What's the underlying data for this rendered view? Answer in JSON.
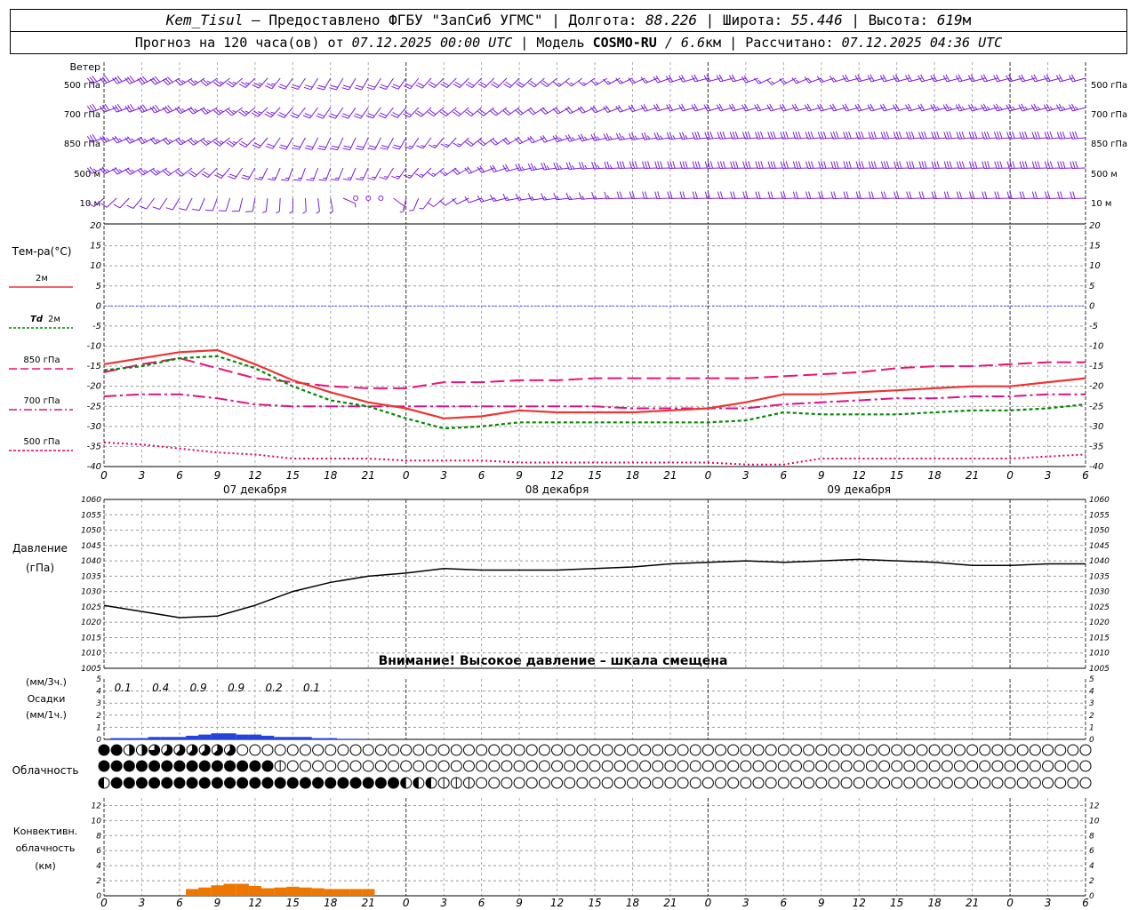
{
  "header": {
    "station": "Kem_Tisul",
    "provider": "– Предоставлено ФГБУ \"ЗапСиб УГМС\"",
    "lon_label": "Долгота:",
    "lon": "88.226",
    "lat_label": "Широта:",
    "lat": "55.446",
    "alt_label": "Высота:",
    "alt": "619",
    "alt_unit": "м",
    "forecast_label": "Прогноз на 120 часа(ов) от",
    "forecast_from": "07.12.2025 00:00 UTC",
    "model_label": "Модель",
    "model": "COSMO-RU",
    "resolution": "/ 6.6",
    "resolution_unit": "км",
    "calc_label": "Рассчитано:",
    "calc_time": "07.12.2025 04:36 UTC"
  },
  "labels": {
    "wind_title": "Ветер",
    "wind_levels": [
      "500 гПа",
      "700 гПа",
      "850 гПа",
      "500 м",
      "10  м"
    ],
    "temp_title": "Тем-ра(°C)",
    "temp_2m": "2м",
    "td_prefix": "Td",
    "td_2m": "2м",
    "t850": "850 гПа",
    "t700": "700 гПа",
    "t500": "500 гПа",
    "pressure_title": "Давление",
    "pressure_unit": "(гПа)",
    "warning": "Внимание! Высокое давление – шкала смещена",
    "precip_unit3": "(мм/3ч.)",
    "precip_title": "Осадки",
    "precip_unit1": "(мм/1ч.)",
    "cloud_title": "Облачность",
    "conv_title1": "Конвективн.",
    "conv_title2": "облачность",
    "conv_unit": "(км)"
  },
  "colors": {
    "wind": "#7b1fd6",
    "t2m": "#ee3333",
    "td": "#008800",
    "t850": "#ee1177",
    "t700": "#dd1188",
    "t500": "#dd0066",
    "zero": "#3355ff",
    "pressure": "#000000",
    "precip": "#2244dd",
    "conv": "#ee7700"
  },
  "chart_data": [
    {
      "type": "wind-barbs",
      "levels": [
        "500 гПа",
        "700 гПа",
        "850 гПа",
        "500 м",
        "10  м"
      ],
      "x_hours": [
        0,
        3,
        6,
        9,
        12,
        15,
        18,
        21,
        24,
        27,
        30,
        33,
        36,
        39,
        42,
        45,
        48,
        51,
        54,
        57,
        60,
        63,
        66,
        69,
        72,
        75,
        78
      ],
      "direction_deg": [
        [
          245,
          245,
          240,
          235,
          225,
          215,
          210,
          210,
          215,
          225,
          225,
          225,
          230,
          235,
          245,
          250,
          255,
          255,
          240,
          250,
          255,
          255,
          255,
          255,
          255,
          255,
          255
        ],
        [
          250,
          250,
          245,
          240,
          230,
          220,
          215,
          215,
          220,
          230,
          230,
          235,
          240,
          245,
          250,
          255,
          255,
          255,
          255,
          255,
          255,
          255,
          255,
          255,
          255,
          255,
          255
        ],
        [
          250,
          245,
          240,
          235,
          225,
          210,
          205,
          205,
          210,
          220,
          230,
          240,
          250,
          255,
          260,
          262,
          264,
          265,
          265,
          265,
          265,
          265,
          265,
          265,
          265,
          265,
          265
        ],
        [
          245,
          240,
          235,
          225,
          210,
          200,
          200,
          205,
          215,
          230,
          245,
          255,
          262,
          265,
          268,
          268,
          268,
          268,
          268,
          268,
          268,
          268,
          268,
          268,
          268,
          268,
          268
        ],
        [
          230,
          220,
          210,
          200,
          190,
          180,
          170,
          0,
          190,
          230,
          250,
          260,
          262,
          265,
          268,
          268,
          268,
          268,
          268,
          268,
          268,
          268,
          268,
          268,
          268,
          268,
          268
        ]
      ],
      "speed_ms": [
        [
          16,
          15,
          14,
          13,
          12,
          11,
          10,
          10,
          10,
          9,
          9,
          9,
          9,
          8,
          8,
          9,
          9,
          10,
          7,
          8,
          9,
          9,
          9,
          9,
          10,
          10,
          10
        ],
        [
          15,
          15,
          14,
          13,
          12,
          11,
          10,
          9,
          9,
          9,
          9,
          9,
          9,
          9,
          10,
          10,
          10,
          10,
          10,
          10,
          11,
          11,
          11,
          12,
          12,
          12,
          12
        ],
        [
          14,
          13,
          13,
          12,
          11,
          10,
          9,
          9,
          9,
          8,
          9,
          10,
          11,
          12,
          13,
          13,
          14,
          14,
          14,
          15,
          15,
          15,
          15,
          15,
          15,
          16,
          16
        ],
        [
          12,
          12,
          11,
          10,
          9,
          8,
          7,
          7,
          8,
          8,
          10,
          11,
          12,
          13,
          14,
          14,
          14,
          15,
          15,
          15,
          15,
          15,
          15,
          16,
          16,
          16,
          16
        ],
        [
          6,
          5,
          5,
          4,
          4,
          3,
          2,
          0,
          2,
          4,
          6,
          7,
          8,
          8,
          9,
          9,
          9,
          9,
          9,
          9,
          9,
          9,
          9,
          9,
          9,
          9,
          9
        ]
      ]
    },
    {
      "type": "line",
      "title": "Тем-ра(°C)",
      "x_hours": [
        0,
        3,
        6,
        9,
        12,
        15,
        18,
        21,
        24,
        27,
        30,
        33,
        36,
        39,
        42,
        45,
        48,
        51,
        54,
        57,
        60,
        63,
        66,
        69,
        72,
        75,
        78
      ],
      "ylim": [
        -40,
        20
      ],
      "yticks": [
        20,
        15,
        10,
        5,
        0,
        -5,
        -10,
        -15,
        -20,
        -25,
        -30,
        -35,
        -40
      ],
      "series": [
        {
          "name": "2м",
          "key": "t2m",
          "dash": "",
          "width": 2.2,
          "values": [
            -14.5,
            -13,
            -11.5,
            -11,
            -14.5,
            -18.5,
            -21.5,
            -24,
            -25.5,
            -28,
            -27.5,
            -26,
            -26.5,
            -26.5,
            -26.5,
            -26,
            -25.5,
            -24,
            -22,
            -22,
            -21.5,
            -21,
            -20.5,
            -20,
            -20,
            -19,
            -18
          ]
        },
        {
          "name": "Td 2м",
          "key": "td",
          "dash": "4,3",
          "width": 2.2,
          "values": [
            -16,
            -15,
            -13,
            -12.5,
            -15.5,
            -20,
            -23.5,
            -25,
            -28,
            -30.5,
            -30,
            -29,
            -29,
            -29,
            -29,
            -29,
            -29,
            -28.5,
            -26.5,
            -27,
            -27,
            -27,
            -26.5,
            -26,
            -26,
            -25.5,
            -24.5
          ]
        },
        {
          "name": "850 гПа",
          "key": "t850",
          "dash": "16,6",
          "width": 2,
          "values": [
            -16.5,
            -14.5,
            -13,
            -15.5,
            -18,
            -19,
            -20,
            -20.5,
            -20.5,
            -19,
            -19,
            -18.5,
            -18.5,
            -18,
            -18,
            -18,
            -18,
            -18,
            -17.5,
            -17,
            -16.5,
            -15.5,
            -15,
            -15,
            -14.5,
            -14,
            -14
          ]
        },
        {
          "name": "700 гПа",
          "key": "t700",
          "dash": "14,4,3,4",
          "width": 2,
          "values": [
            -22.5,
            -22,
            -22,
            -23,
            -24.5,
            -25,
            -25,
            -25,
            -25,
            -25,
            -25,
            -25,
            -25,
            -25,
            -25.5,
            -25.5,
            -25.5,
            -25.5,
            -24.5,
            -24,
            -23.5,
            -23,
            -23,
            -22.5,
            -22.5,
            -22,
            -22
          ]
        },
        {
          "name": "500 гПа",
          "key": "t500",
          "dash": "2,3",
          "width": 2,
          "values": [
            -34,
            -34.5,
            -35.5,
            -36.5,
            -37,
            -38,
            -38,
            -38,
            -38.5,
            -38.5,
            -38.5,
            -39,
            -39,
            -39,
            -39,
            -39,
            -39,
            -39.5,
            -39.5,
            -38,
            -38,
            -38,
            -38,
            -38,
            -38,
            -37.5,
            -37
          ]
        }
      ],
      "zero_line": 0
    },
    {
      "type": "line",
      "title": "Давление",
      "x_hours": [
        0,
        3,
        6,
        9,
        12,
        15,
        18,
        21,
        24,
        27,
        30,
        33,
        36,
        39,
        42,
        45,
        48,
        51,
        54,
        57,
        60,
        63,
        66,
        69,
        72,
        75,
        78
      ],
      "ylim": [
        1005,
        1060
      ],
      "yticks": [
        1060,
        1055,
        1050,
        1045,
        1040,
        1035,
        1030,
        1025,
        1020,
        1015,
        1010,
        1005
      ],
      "series": [
        {
          "name": "Давление",
          "values": [
            1025.5,
            1023.5,
            1021.5,
            1022,
            1025.5,
            1030,
            1033,
            1035,
            1036,
            1037.5,
            1037,
            1037,
            1037,
            1037.5,
            1038,
            1039,
            1039.5,
            1040,
            1039.5,
            1040,
            1040.5,
            1040,
            1039.5,
            1038.5,
            1038.5,
            1039,
            1039
          ]
        }
      ]
    },
    {
      "type": "bar",
      "title": "Осадки",
      "ylim": [
        0,
        5
      ],
      "yticks": [
        5,
        4,
        3,
        2,
        1,
        0
      ],
      "bar_hours": [
        1,
        2,
        3,
        4,
        5,
        6,
        7,
        8,
        9,
        10,
        11,
        12,
        13,
        14,
        15,
        16,
        17,
        18,
        19,
        20
      ],
      "bar_values": [
        0.1,
        0.1,
        0.1,
        0.2,
        0.2,
        0.2,
        0.3,
        0.4,
        0.5,
        0.5,
        0.4,
        0.4,
        0.3,
        0.2,
        0.2,
        0.2,
        0.1,
        0.1,
        0.05,
        0.05
      ],
      "totals_3h": [
        "0.1",
        "0.4",
        "0.9",
        "0.9",
        "0.2",
        "0.1"
      ]
    },
    {
      "type": "cloud-symbols",
      "title": "Облачность",
      "n_columns": 79,
      "rows": [
        "nnhhtqqqqqq",
        "nnnnnnnnnnnnnnw",
        "unnnnnnnnnnnnnnnnnnnnnnnuuuwww"
      ]
    },
    {
      "type": "bar",
      "title": "Конвективн. облачность",
      "ylim": [
        0,
        13
      ],
      "yticks": [
        12,
        10,
        8,
        6,
        4,
        2,
        0
      ],
      "bar_hours": [
        7,
        8,
        9,
        10,
        11,
        12,
        13,
        14,
        15,
        16,
        17,
        18,
        19,
        20,
        21
      ],
      "bar_values": [
        0.9,
        1.1,
        1.4,
        1.6,
        1.6,
        1.3,
        1.0,
        1.1,
        1.2,
        1.1,
        1.0,
        0.9,
        0.9,
        0.9,
        0.9
      ]
    }
  ],
  "axis": {
    "tick_labels": [
      "0",
      "3",
      "6",
      "9",
      "12",
      "15",
      "18",
      "21",
      "0",
      "3",
      "6",
      "9",
      "12",
      "15",
      "18",
      "21",
      "0",
      "3",
      "6",
      "9",
      "12",
      "15",
      "18",
      "21",
      "0",
      "3",
      "6"
    ],
    "day_labels": [
      "07 декабря",
      "08 декабря",
      "09 декабря"
    ]
  }
}
